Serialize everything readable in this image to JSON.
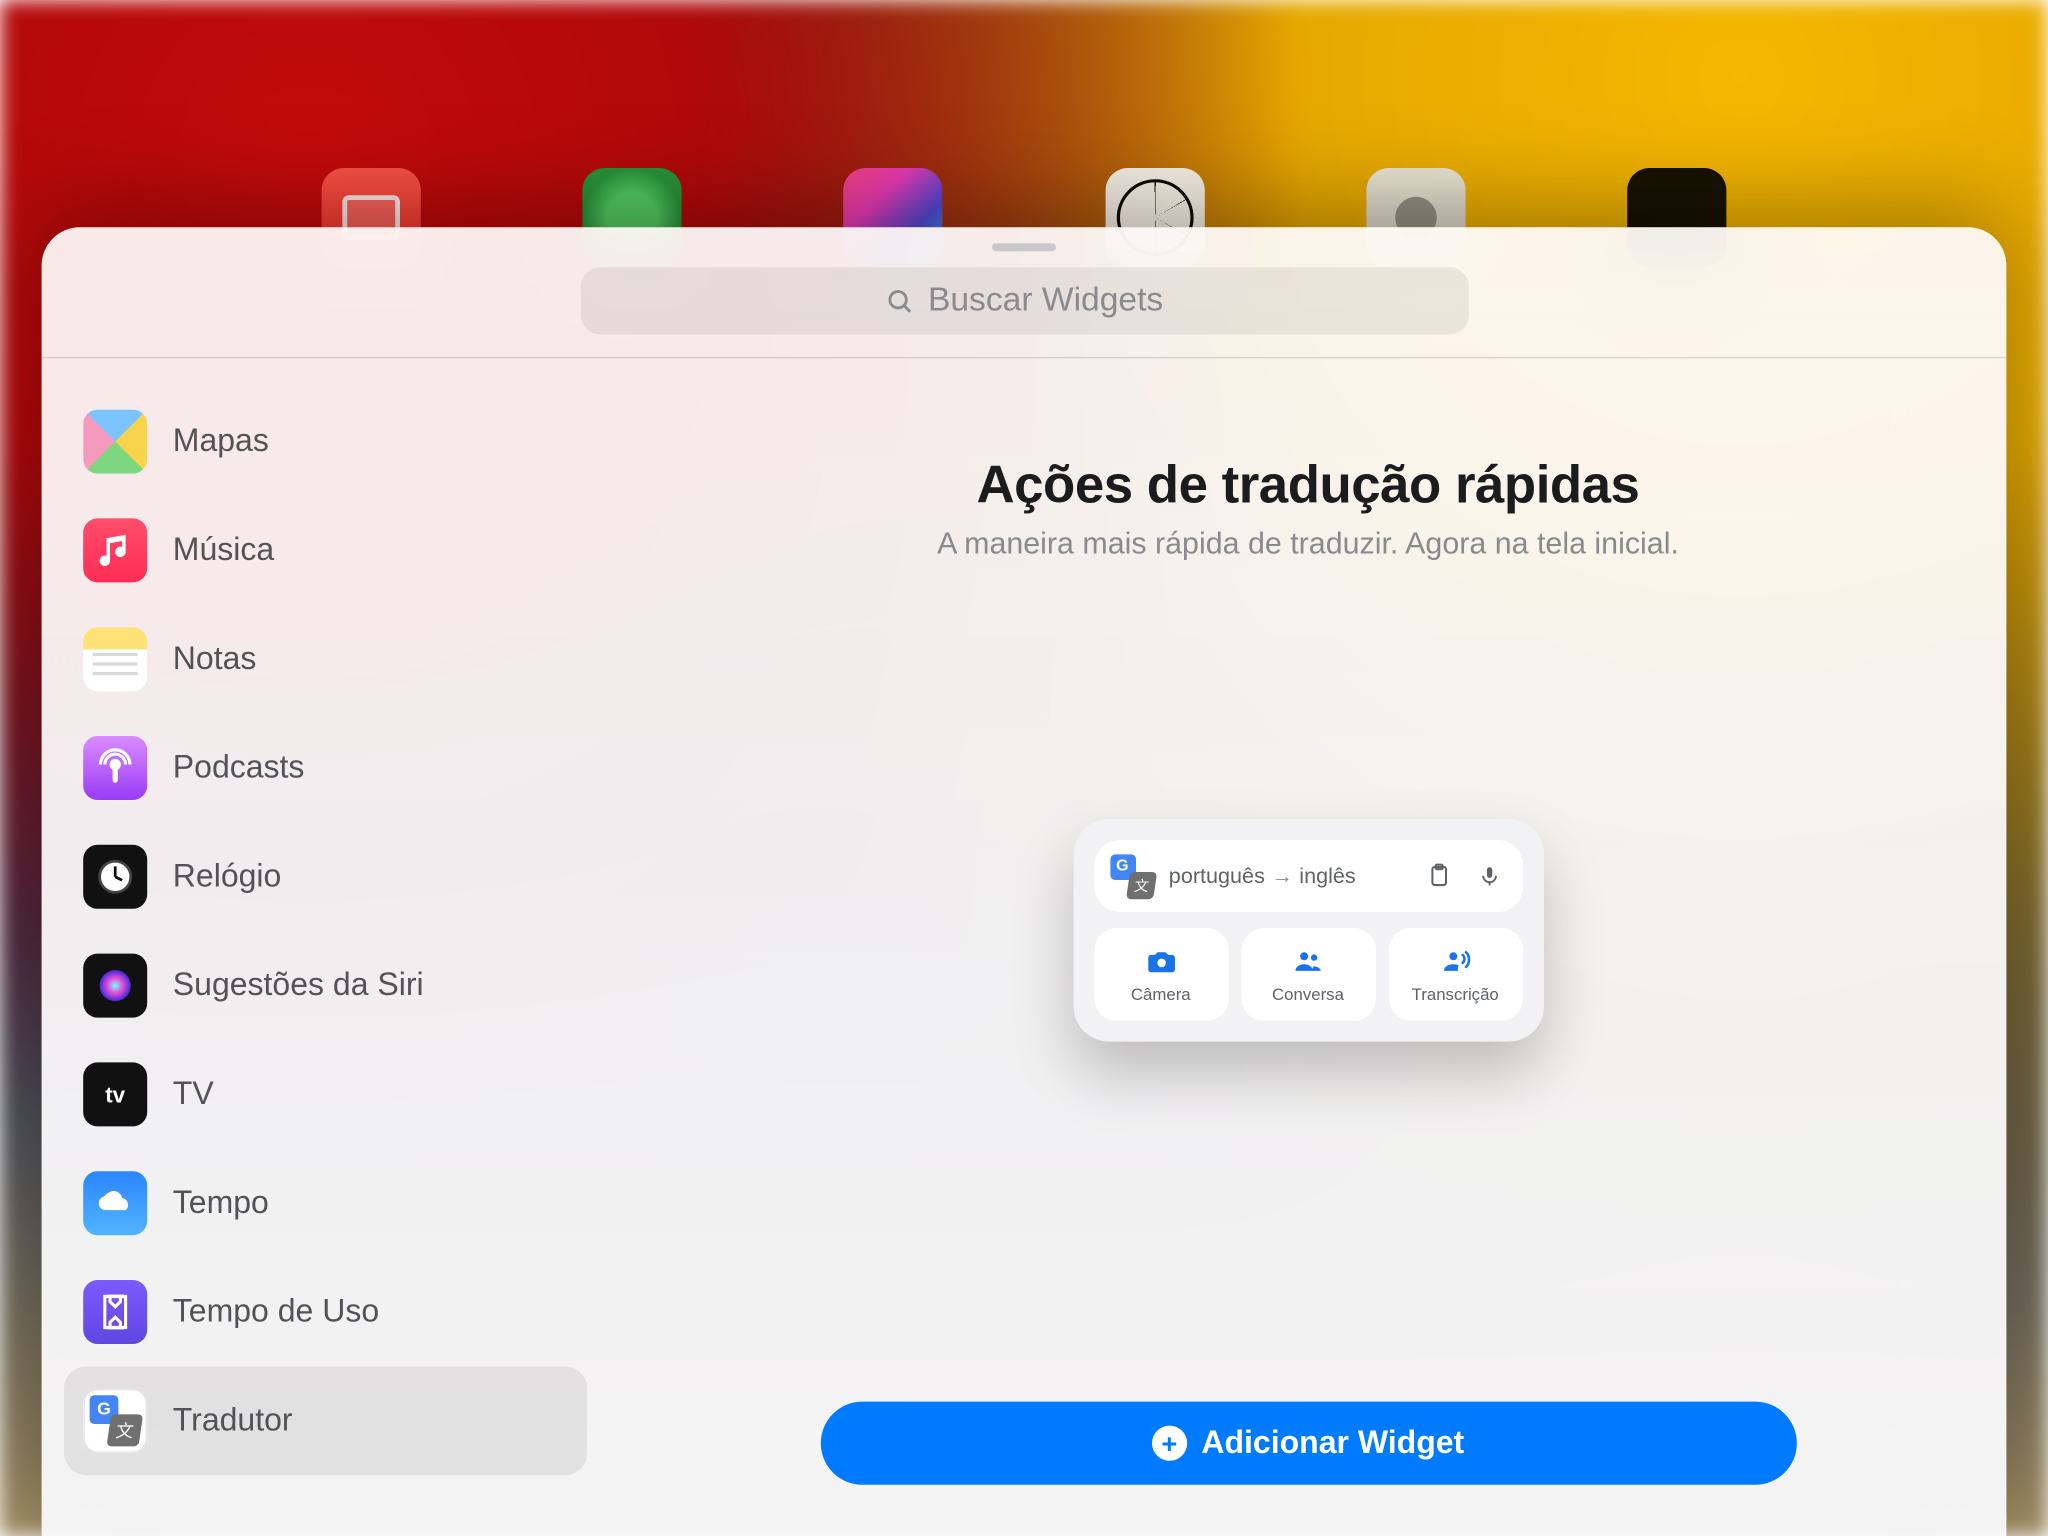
{
  "search": {
    "placeholder": "Buscar Widgets"
  },
  "sidebar": {
    "items": [
      {
        "label": "Mapas"
      },
      {
        "label": "Música"
      },
      {
        "label": "Notas"
      },
      {
        "label": "Podcasts"
      },
      {
        "label": "Relógio"
      },
      {
        "label": "Sugestões da Siri"
      },
      {
        "label": "TV"
      },
      {
        "label": "Tempo"
      },
      {
        "label": "Tempo de Uso"
      },
      {
        "label": "Tradutor"
      }
    ],
    "selected_index": 9
  },
  "main": {
    "title": "Ações de tradução rápidas",
    "subtitle": "A maneira mais rápida de traduzir. Agora na tela inicial."
  },
  "widget_preview": {
    "lang_from": "português",
    "lang_to": "inglês",
    "actions": [
      {
        "label": "Câmera"
      },
      {
        "label": "Conversa"
      },
      {
        "label": "Transcrição"
      }
    ]
  },
  "add_button": {
    "label": "Adicionar Widget"
  },
  "colors": {
    "accent_blue": "#007aff",
    "google_blue": "#1a73e8",
    "text_secondary": "#8a8a8e"
  }
}
